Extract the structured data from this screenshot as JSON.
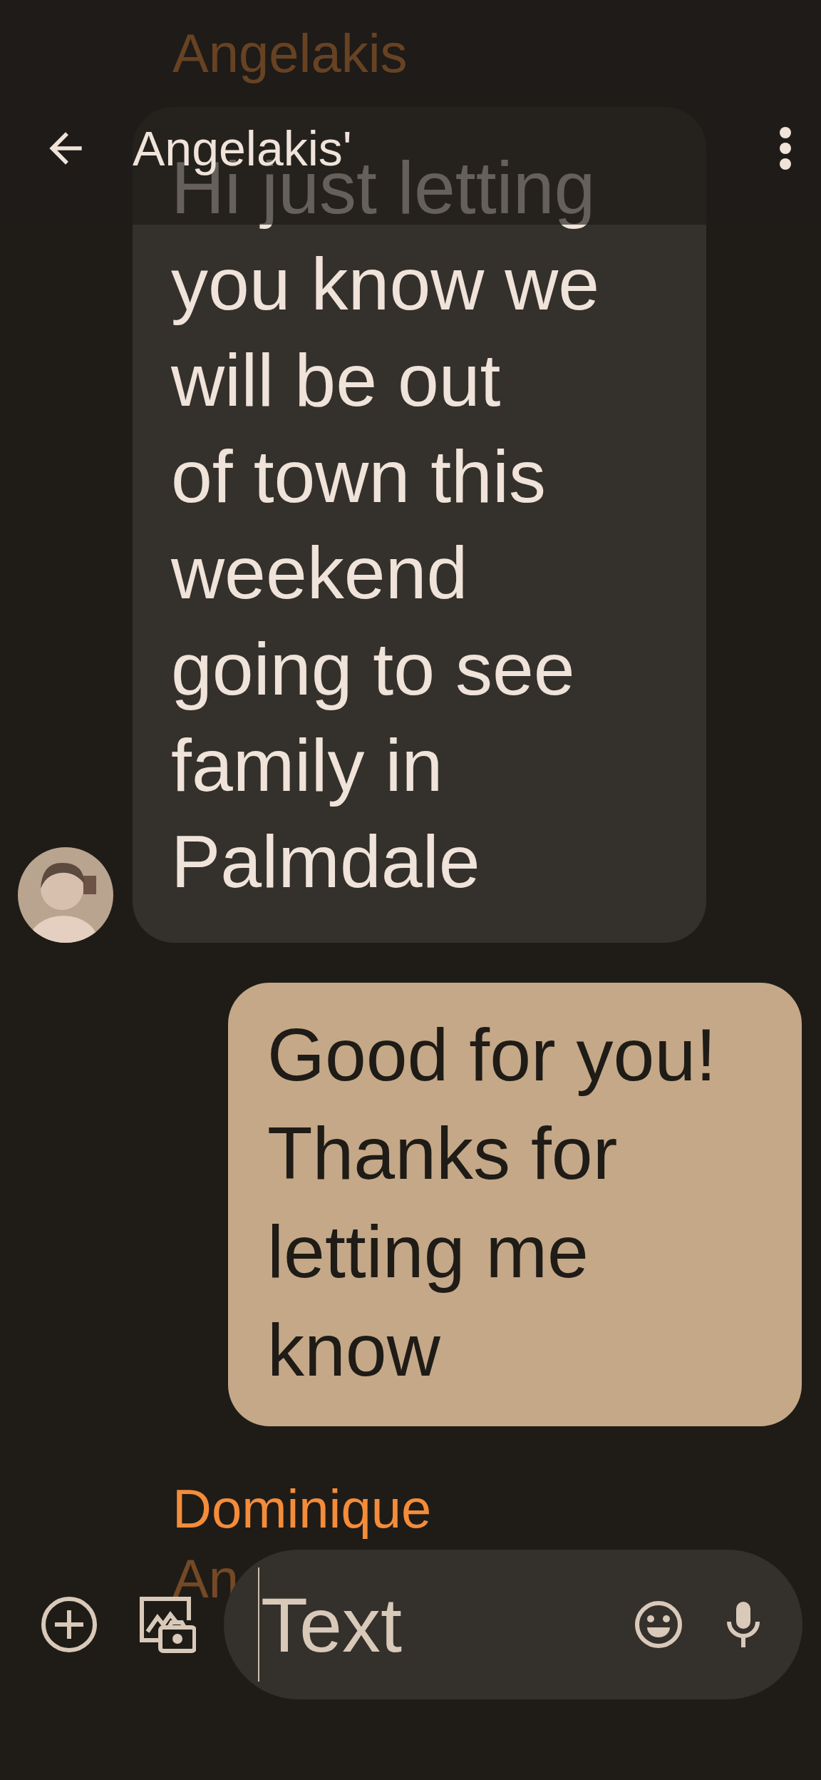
{
  "header": {
    "title": "Angelakis'"
  },
  "messages": [
    {
      "kind": "sender",
      "text": "Angelakis"
    },
    {
      "kind": "incoming",
      "text": "Hi just letting\nyou know we\nwill be out\nof town this\nweekend\ngoing to see\nfamily in\nPalmdale"
    },
    {
      "kind": "outgoing",
      "text": "Good for you!\nThanks for\nletting me\nknow"
    },
    {
      "kind": "sender",
      "text": "Dominique"
    },
    {
      "kind": "sender",
      "text": "An"
    }
  ],
  "composer": {
    "placeholder": "Text"
  }
}
